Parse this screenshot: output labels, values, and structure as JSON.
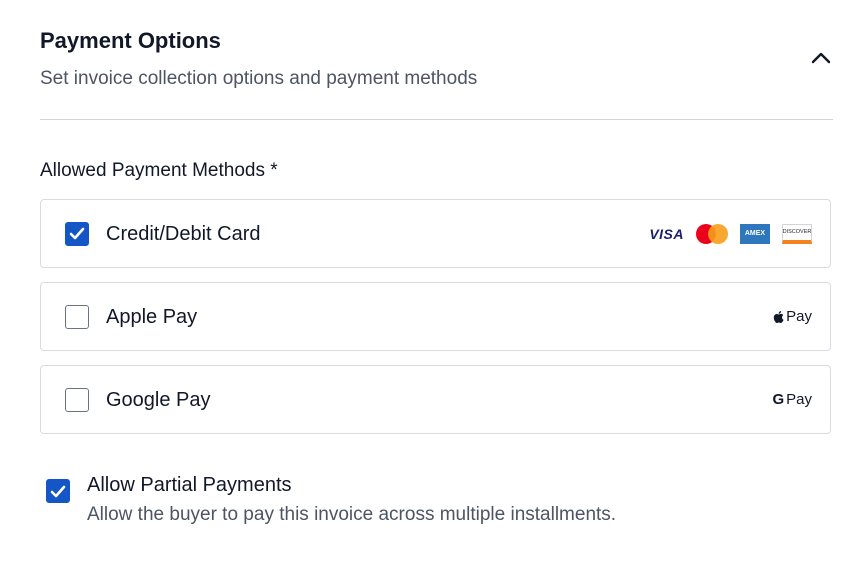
{
  "header": {
    "title": "Payment Options",
    "subtitle": "Set invoice collection options and payment methods",
    "collapse_icon": "chevron-up-icon"
  },
  "methods": {
    "label": "Allowed Payment Methods *",
    "items": [
      {
        "label": "Credit/Debit Card",
        "checked": true,
        "logos": [
          "visa-icon",
          "mastercard-icon",
          "amex-icon",
          "discover-icon"
        ]
      },
      {
        "label": "Apple Pay",
        "checked": false,
        "logos": [
          "apple-pay-icon"
        ]
      },
      {
        "label": "Google Pay",
        "checked": false,
        "logos": [
          "google-pay-icon"
        ]
      }
    ]
  },
  "logos": {
    "visa": "VISA",
    "amex": "AMEX",
    "discover": "DISCOVER",
    "apple_pay": "Pay",
    "google_g": "G",
    "google_pay": "Pay"
  },
  "partial": {
    "title": "Allow Partial Payments",
    "description": "Allow the buyer to pay this invoice across multiple installments.",
    "checked": true
  },
  "colors": {
    "accent": "#1556c7",
    "text": "#111827",
    "muted": "#4b5563",
    "border": "#d8dbe0"
  }
}
